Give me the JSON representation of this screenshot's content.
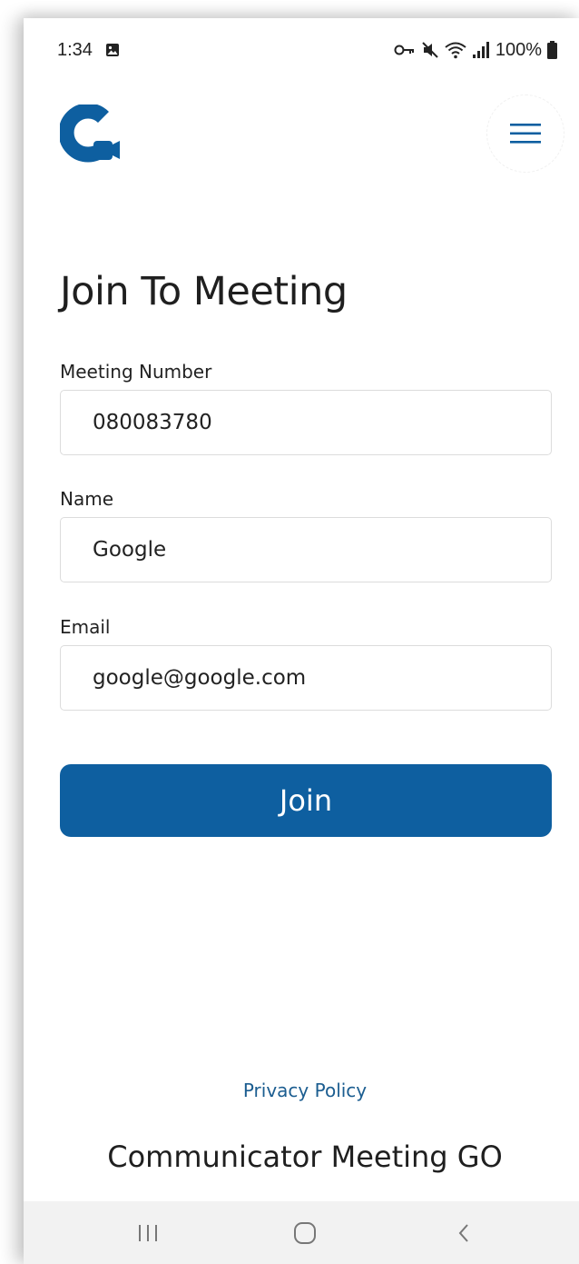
{
  "status_bar": {
    "time": "1:34",
    "battery": "100%",
    "icons": [
      "gallery-icon",
      "vpn-key-icon",
      "mute-icon",
      "wifi-icon",
      "signal-icon",
      "battery-icon"
    ]
  },
  "header": {
    "logo": "communicator-logo-icon",
    "menu_icon": "hamburger-menu-icon"
  },
  "main": {
    "title": "Join To Meeting",
    "meeting_number": {
      "label": "Meeting Number",
      "value": "080083780"
    },
    "name": {
      "label": "Name",
      "value": "Google"
    },
    "email": {
      "label": "Email",
      "value": "google@google.com"
    },
    "join_label": "Join"
  },
  "footer": {
    "privacy_link": "Privacy Policy",
    "app_name": "Communicator Meeting GO"
  },
  "nav_bar": {
    "icons": [
      "recent-apps-icon",
      "home-icon",
      "back-icon"
    ]
  },
  "colors": {
    "accent": "#0e5fa0",
    "link": "#1b5d90",
    "nav_bg": "#f2f2f2"
  }
}
